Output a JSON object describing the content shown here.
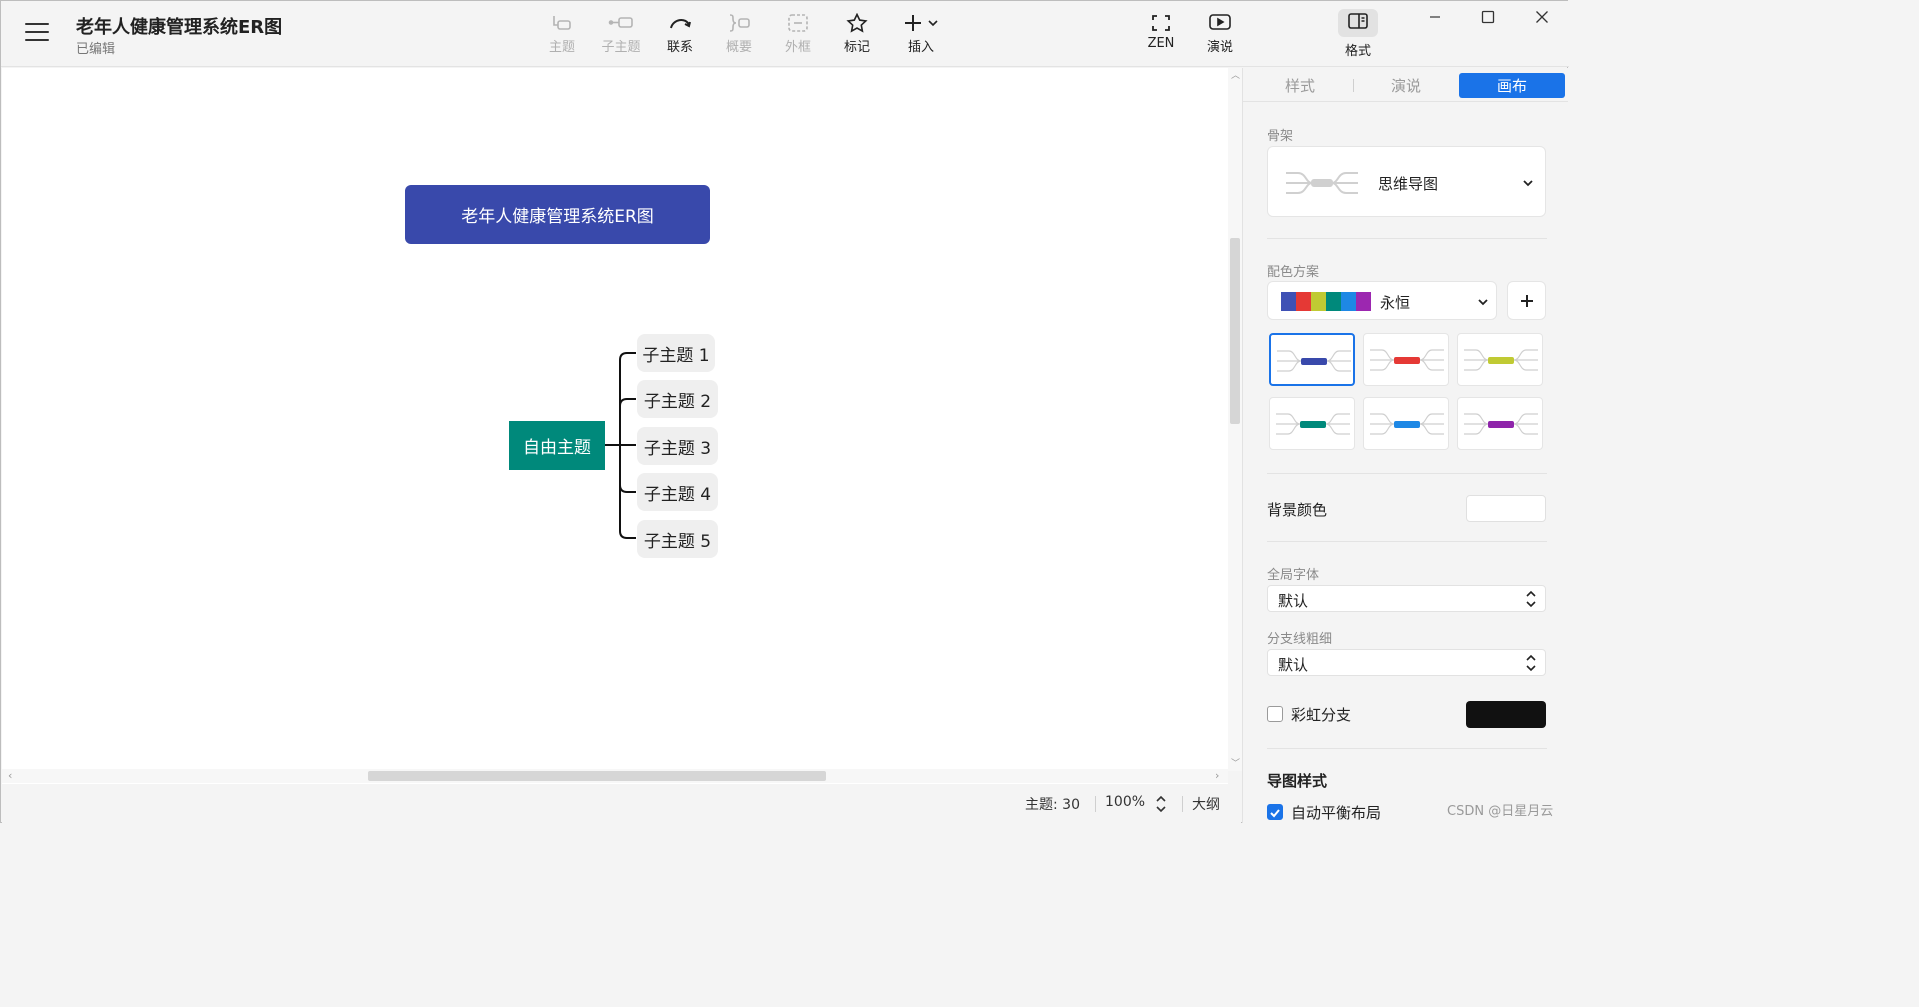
{
  "header": {
    "title": "老年人健康管理系统ER图",
    "status": "已编辑"
  },
  "toolbar": {
    "topic": "主题",
    "subtopic": "子主题",
    "relation": "联系",
    "summary": "概要",
    "boundary": "外框",
    "marker": "标记",
    "insert": "插入",
    "zen": "ZEN",
    "pitch": "演说",
    "format": "格式"
  },
  "canvas": {
    "main_topic": "老年人健康管理系统ER图",
    "free_topic": "自由主题",
    "subtopics": [
      "子主题 1",
      "子主题 2",
      "子主题 3",
      "子主题 4",
      "子主题 5"
    ]
  },
  "statusbar": {
    "topic_count": "主题: 30",
    "zoom": "100%",
    "outline": "大纲"
  },
  "panel": {
    "tabs": [
      "样式",
      "演说",
      "画布"
    ],
    "active_tab": "画布",
    "skeleton_label": "骨架",
    "skeleton_value": "思维导图",
    "color_scheme_label": "配色方案",
    "color_scheme_value": "永恒",
    "scheme_swatches": [
      "#3f51b5",
      "#e53935",
      "#c0ca33",
      "#00897b",
      "#1e88e5",
      "#9c27b0"
    ],
    "theme_colors": [
      "#3949ab",
      "#e53935",
      "#c0ca33",
      "#00897b",
      "#1e88e5",
      "#8e24aa"
    ],
    "bg_color_label": "背景颜色",
    "bg_color_value": "#ffffff",
    "global_font_label": "全局字体",
    "global_font_value": "默认",
    "branch_width_label": "分支线粗细",
    "branch_width_value": "默认",
    "rainbow_label": "彩虹分支",
    "rainbow_color": "#111111",
    "map_style_label": "导图样式",
    "auto_balance_label": "自动平衡布局"
  },
  "colors": {
    "accent": "#1a73e8",
    "main_topic_bg": "#3949ab",
    "free_topic_bg": "#00897b"
  },
  "watermark": "CSDN @日星月云"
}
